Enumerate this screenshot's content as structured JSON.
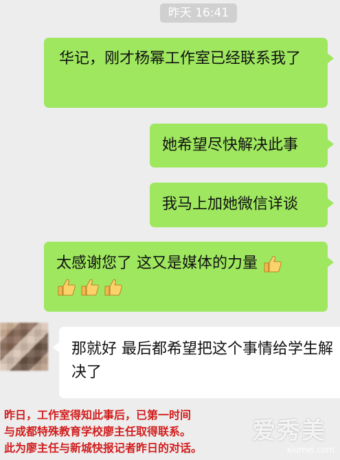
{
  "timestamp": "昨天 16:41",
  "messages": [
    {
      "side": "right",
      "text": "华记，刚才杨幂工作室已经联系我了"
    },
    {
      "side": "right",
      "text": "她希望尽快解决此事"
    },
    {
      "side": "right",
      "text": "我马上加她微信详谈"
    },
    {
      "side": "right",
      "text": "太感谢您了  这又是媒体的力量",
      "emoji": "thumbs-up-icon",
      "emoji_count": 4
    },
    {
      "side": "left",
      "text": "那就好  最后都希望把这个事情给学生解决了"
    }
  ],
  "caption": "昨日，工作室得知此事后，已第一时间\n与成都特殊教育学校廖主任取得联系。\n此为廖主任与新城快报记者昨日的对话。",
  "watermark": {
    "text": "爱秀美",
    "url": "xiumei.com"
  },
  "colors": {
    "sent_bubble": "#9ee75f",
    "received_bubble": "#ffffff",
    "background": "#ededed",
    "caption": "#d21d1d"
  }
}
